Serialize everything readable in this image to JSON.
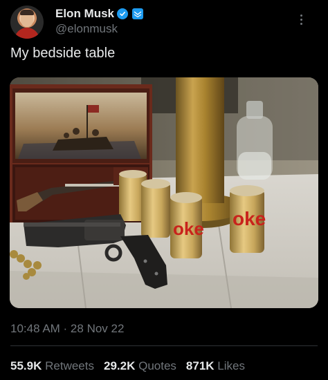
{
  "author": {
    "display_name": "Elon Musk",
    "handle": "@elonmusk",
    "verified": true,
    "affiliation_badge": true
  },
  "tweet": {
    "text": "My bedside table",
    "timestamp": "10:48 AM · 28 Nov 22"
  },
  "photo": {
    "can_texts": [
      "oke",
      "oke",
      "oke"
    ]
  },
  "stats": {
    "retweets_count": "55.9K",
    "retweets_label": "Retweets",
    "quotes_count": "29.2K",
    "quotes_label": "Quotes",
    "likes_count": "871K",
    "likes_label": "Likes"
  },
  "colors": {
    "background": "#000000",
    "primary_text": "#e7e9ea",
    "secondary_text": "#71767b",
    "verified_blue": "#1d9bf0"
  }
}
